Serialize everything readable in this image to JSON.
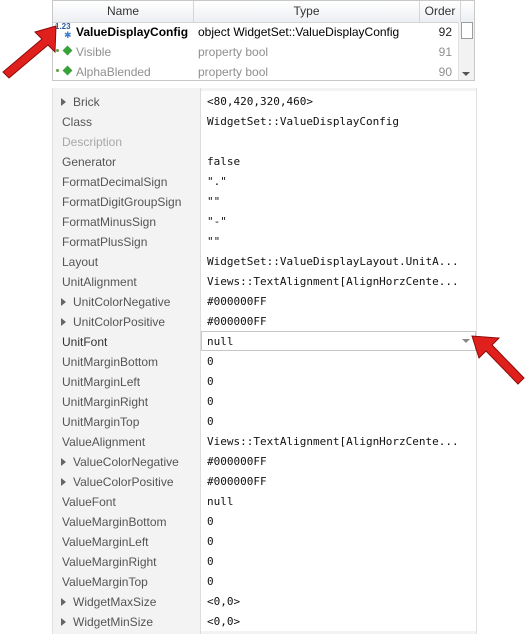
{
  "members": {
    "headers": {
      "name": "Name",
      "type": "Type",
      "order": "Order"
    },
    "rows": [
      {
        "name": "ValueDisplayConfig",
        "type": "object WidgetSet::ValueDisplayConfig",
        "order": "92",
        "icon": "value-123-icon"
      },
      {
        "name": "Visible",
        "type": "property bool",
        "order": "91",
        "icon": "green-diamond-icon"
      },
      {
        "name": "AlphaBlended",
        "type": "property bool",
        "order": "90",
        "icon": "green-diamond-icon"
      }
    ],
    "icon_label": "1.23"
  },
  "properties": [
    {
      "name": "Brick",
      "value": "<80,420,320,460>",
      "expandable": true
    },
    {
      "name": "Class",
      "value": "WidgetSet::ValueDisplayConfig"
    },
    {
      "name": "Description",
      "value": "",
      "disabled": true
    },
    {
      "name": "Generator",
      "value": "false"
    },
    {
      "name": "FormatDecimalSign",
      "value": "\".\""
    },
    {
      "name": "FormatDigitGroupSign",
      "value": "\"\""
    },
    {
      "name": "FormatMinusSign",
      "value": "\"-\""
    },
    {
      "name": "FormatPlusSign",
      "value": "\"\""
    },
    {
      "name": "Layout",
      "value": "WidgetSet::ValueDisplayLayout.UnitA..."
    },
    {
      "name": "UnitAlignment",
      "value": "Views::TextAlignment[AlignHorzCente..."
    },
    {
      "name": "UnitColorNegative",
      "value": "#000000FF",
      "expandable": true
    },
    {
      "name": "UnitColorPositive",
      "value": "#000000FF",
      "expandable": true
    },
    {
      "name": "UnitFont",
      "value": "null",
      "selected": true
    },
    {
      "name": "UnitMarginBottom",
      "value": "0"
    },
    {
      "name": "UnitMarginLeft",
      "value": "0"
    },
    {
      "name": "UnitMarginRight",
      "value": "0"
    },
    {
      "name": "UnitMarginTop",
      "value": "0"
    },
    {
      "name": "ValueAlignment",
      "value": "Views::TextAlignment[AlignHorzCente..."
    },
    {
      "name": "ValueColorNegative",
      "value": "#000000FF",
      "expandable": true
    },
    {
      "name": "ValueColorPositive",
      "value": "#000000FF",
      "expandable": true
    },
    {
      "name": "ValueFont",
      "value": "null"
    },
    {
      "name": "ValueMarginBottom",
      "value": "0"
    },
    {
      "name": "ValueMarginLeft",
      "value": "0"
    },
    {
      "name": "ValueMarginRight",
      "value": "0"
    },
    {
      "name": "ValueMarginTop",
      "value": "0"
    },
    {
      "name": "WidgetMaxSize",
      "value": "<0,0>",
      "expandable": true
    },
    {
      "name": "WidgetMinSize",
      "value": "<0,0>",
      "expandable": true
    }
  ],
  "colors": {
    "annotation_arrow": "#e0201c",
    "grid_background": "#f3f3f3",
    "value_background": "#ffffff"
  }
}
